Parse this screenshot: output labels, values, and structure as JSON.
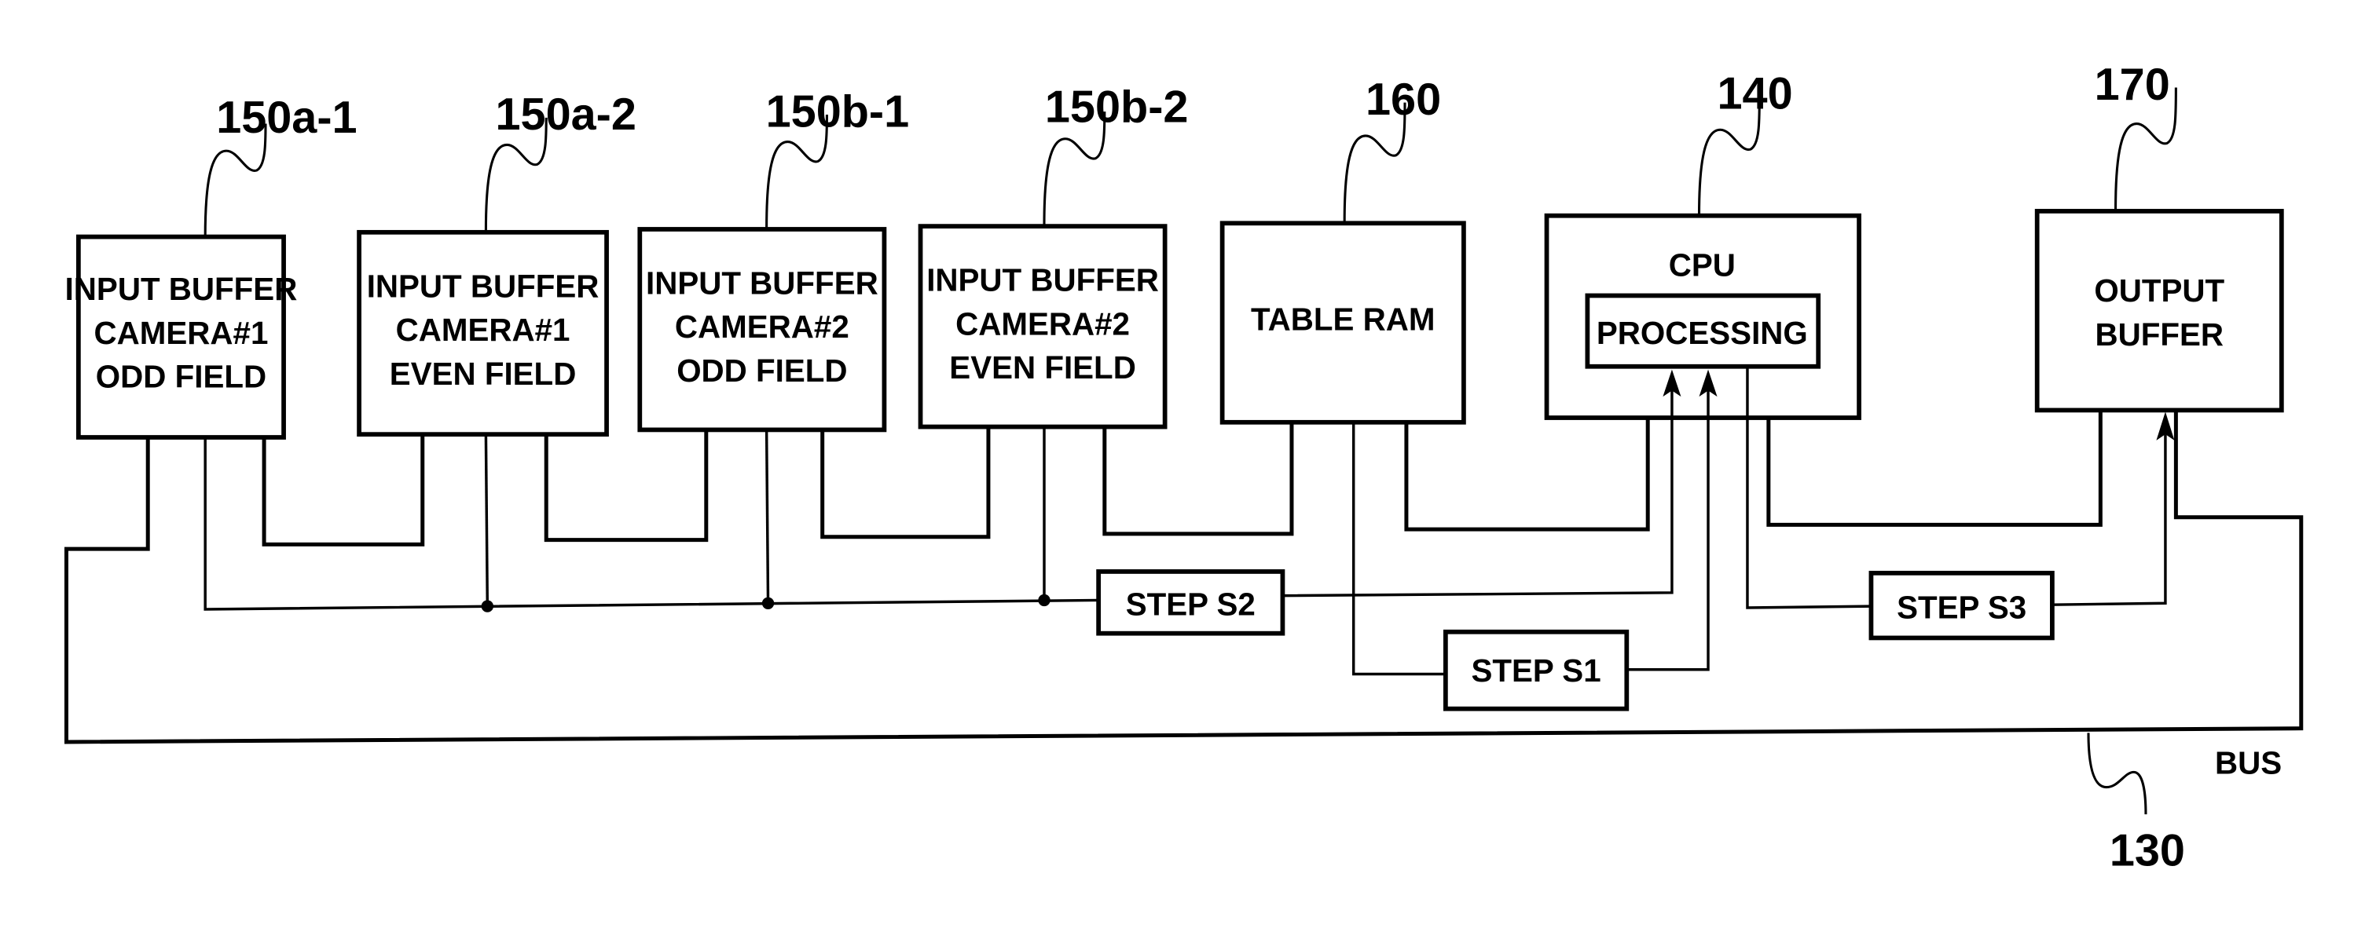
{
  "diagram": {
    "blocks": [
      {
        "id": "150a-1",
        "ref": "150a-1",
        "lines": [
          "INPUT BUFFER",
          "CAMERA#1",
          "ODD FIELD"
        ]
      },
      {
        "id": "150a-2",
        "ref": "150a-2",
        "lines": [
          "INPUT BUFFER",
          "CAMERA#1",
          "EVEN FIELD"
        ]
      },
      {
        "id": "150b-1",
        "ref": "150b-1",
        "lines": [
          "INPUT BUFFER",
          "CAMERA#2",
          "ODD FIELD"
        ]
      },
      {
        "id": "150b-2",
        "ref": "150b-2",
        "lines": [
          "INPUT BUFFER",
          "CAMERA#2",
          "EVEN FIELD"
        ]
      },
      {
        "id": "160",
        "ref": "160",
        "lines": [
          "TABLE RAM"
        ]
      },
      {
        "id": "140",
        "ref": "140",
        "lines": [
          "CPU"
        ],
        "inner": "PROCESSING"
      },
      {
        "id": "170",
        "ref": "170",
        "lines": [
          "OUTPUT",
          "BUFFER"
        ]
      }
    ],
    "steps": {
      "s1": "STEP S1",
      "s2": "STEP S2",
      "s3": "STEP S3"
    },
    "bus": {
      "label": "BUS",
      "ref": "130"
    }
  }
}
